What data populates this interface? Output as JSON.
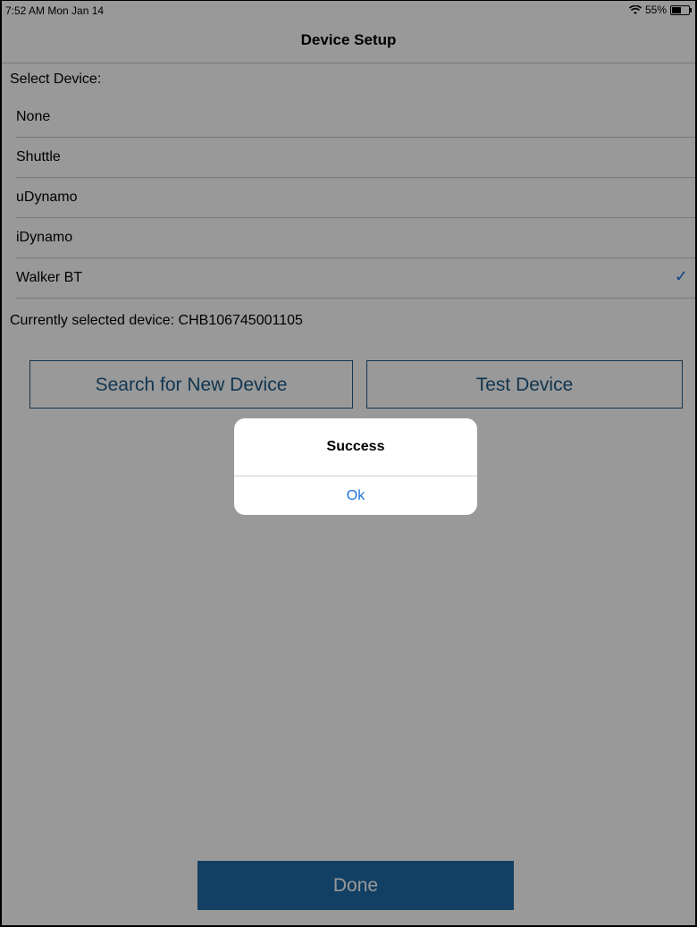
{
  "status_bar": {
    "time": "7:52 AM  Mon Jan 14",
    "battery": "55%",
    "battery_level": 0.55
  },
  "nav": {
    "title": "Device Setup"
  },
  "select_label": "Select Device:",
  "devices": [
    {
      "label": "None",
      "selected": false
    },
    {
      "label": "Shuttle",
      "selected": false
    },
    {
      "label": "uDynamo",
      "selected": false
    },
    {
      "label": "iDynamo",
      "selected": false
    },
    {
      "label": "Walker BT",
      "selected": true
    }
  ],
  "check_mark": "✓",
  "current_device": "Currently selected device: CHB106745001105",
  "buttons": {
    "search": "Search for New Device",
    "test": "Test Device",
    "done": "Done"
  },
  "alert": {
    "title": "Success",
    "ok": "Ok"
  },
  "colors": {
    "accent": "#1a73d9",
    "button_border": "#1e5b87",
    "done_bg": "#1f6ba7",
    "dim_overlay": "rgba(0,0,0,0.4)"
  },
  "icons": {
    "wifi": "wifi-icon",
    "battery": "battery-icon",
    "checkmark": "checkmark-icon"
  }
}
